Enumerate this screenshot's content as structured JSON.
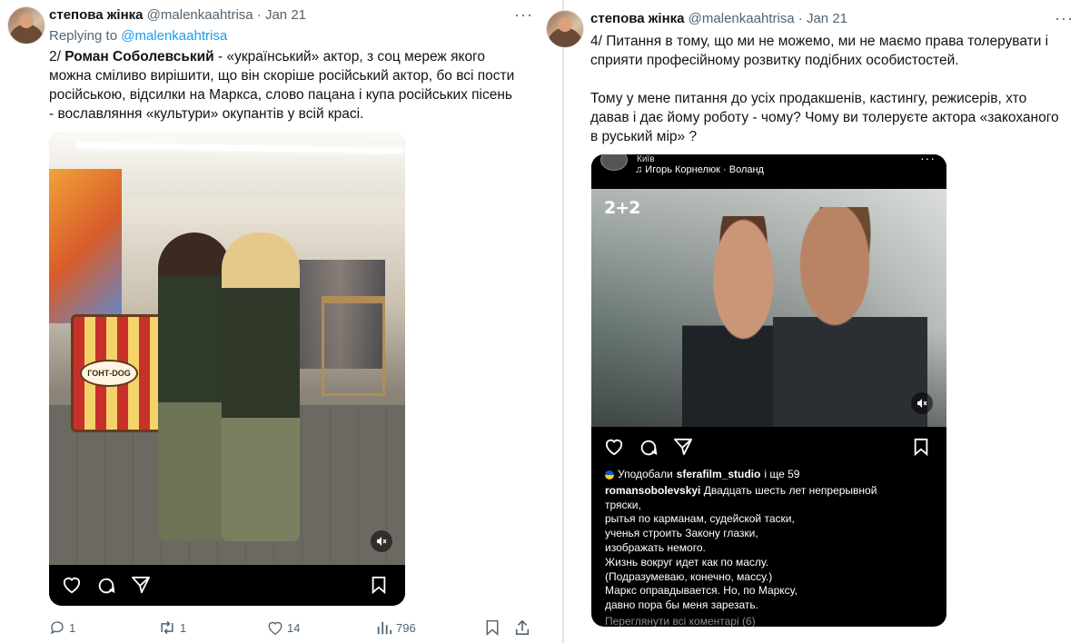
{
  "left_tweet": {
    "author_name": "степова жінка",
    "handle": "@malenkaahtrisa",
    "separator": "·",
    "date": "Jan 21",
    "more": "···",
    "replying_prefix": "Replying to",
    "replying_mention": "@malenkaahtrisa",
    "text_number": "2/",
    "text_name": "Роман Соболевський",
    "text_line1_rest": " - «український» актор, з соц мереж якого",
    "text_line2": "можна сміливо вирішити, що він скоріше російський актор, бо всі пости",
    "text_line3": "російською, відсилки на Маркса, слово пацана і купа російських пісень",
    "text_line4": "- вославляння «культури» окупантів у всій красі.",
    "media": {
      "sign_text": "ГОНТ-DOG"
    },
    "actions": {
      "replies": "1",
      "retweets": "1",
      "likes": "14",
      "views": "796"
    }
  },
  "right_tweet": {
    "author_name": "степова жінка",
    "handle": "@malenkaahtrisa",
    "separator": "·",
    "date": "Jan 21",
    "more": "···",
    "text_line1": "4/ Питання в тому, що ми не можемо, ми не маємо права толерувати і",
    "text_line2": "сприяти професійному розвитку подібних особистостей.",
    "text_line3": "Тому у мене питання до усіх продакшенів, кастингу, режисерів, хто",
    "text_line4": "давав і дає йому роботу - чому? Чому ви толеруєте актора «закоханого",
    "text_line5": "в руський мір» ?",
    "instagram": {
      "location": "Київ",
      "music": "♫ Игорь Корнелюк · Воланд",
      "more": "···",
      "tv_logo": "2+2",
      "likes_prefix": "Уподобали",
      "likes_user": "sferafilm_studio",
      "likes_suffix": "і ще 59",
      "caption_user": "romansobolevskyi",
      "caption_lines": [
        " Двадцать шесть лет непрерывной",
        "тряски,",
        "рытья по карманам, судейской таски,",
        "ученья строить Закону глазки,",
        "изображать немого.",
        "Жизнь вокруг идет как по маслу.",
        "(Подразумеваю, конечно, массу.)",
        "Маркс оправдывается. Но, по Марксу,",
        "давно пора бы меня зарезать."
      ],
      "comments_link": "Переглянути всі коментарі (6)"
    }
  },
  "colors": {
    "accent": "#1d9bf0",
    "muted": "#536471",
    "text": "#0f1419"
  }
}
